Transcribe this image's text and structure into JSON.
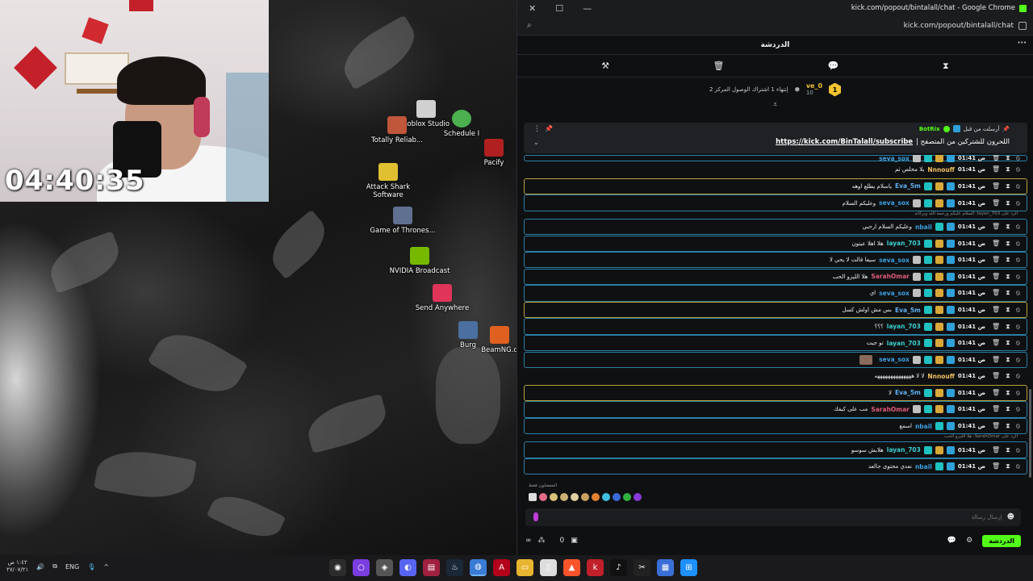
{
  "stream_overlay": {
    "timer": "04:40:35"
  },
  "desktop_icons": [
    {
      "label": "Roblox Studio",
      "color": "#d0d0d0"
    },
    {
      "label": "Schedule I",
      "color": "#4caf50"
    },
    {
      "label": "Totally Reliab...",
      "color": "#c0563a"
    },
    {
      "label": "Pacify",
      "color": "#b02020"
    },
    {
      "label": "Attack Shark Software",
      "color": "#e0c030"
    },
    {
      "label": "Game of Thrones...",
      "color": "#607090"
    },
    {
      "label": "NVIDIA Broadcast",
      "color": "#76b900"
    },
    {
      "label": "Send Anywhere",
      "color": "#e0345a"
    },
    {
      "label": "Burg",
      "color": "#4a6fa0"
    },
    {
      "label": "BeamNG.d",
      "color": "#e06020"
    }
  ],
  "chrome": {
    "title": "kick.com/popout/bintalall/chat - Google Chrome",
    "url": "kick.com/popout/bintalall/chat",
    "window_controls": [
      "✕",
      "☐",
      "—"
    ]
  },
  "chat": {
    "header": "الدردشة",
    "more": "···",
    "toolbar_icons": [
      "hammer-icon",
      "trash-icon",
      "chat-bubble-icon",
      "hourglass-icon"
    ],
    "leaderboard": {
      "rank": "1",
      "username": "ve_0",
      "points": "10",
      "text": "إنتهاء 1 اشتراك الوصول المركز 2"
    },
    "pinned": {
      "prefix": "أرسلت من قبل",
      "author": "BotRix",
      "link": "https://kick.com/BinTalall/subscribe",
      "message": "| اللحرون للشتركين من المتصفح"
    },
    "messages": [
      {
        "time": "01:41 ص",
        "user": "seva_sox",
        "user_color": "#3aa0e0",
        "text": "",
        "border": "blue",
        "badges": [
          "blue",
          "gold",
          "teal",
          "grey"
        ],
        "partial": true
      },
      {
        "time": "01:41 ص",
        "user": "Nnnouff",
        "user_color": "#f0c060",
        "text": "يلا مخلص ثم",
        "border": "plain",
        "badges": []
      },
      {
        "time": "01:41 ص",
        "user": "Eva_5m",
        "user_color": "#60b0f0",
        "text": "ياسلام يطلع اوهه",
        "border": "gold",
        "badges": [
          "blue",
          "gold",
          "teal"
        ]
      },
      {
        "time": "01:41 ص",
        "user": "seva_sox",
        "user_color": "#3aa0e0",
        "text": "وعليكم السلام",
        "border": "blue",
        "badges": [
          "blue",
          "gold",
          "teal",
          "grey"
        ]
      },
      {
        "reply": "الرد على layan_703: السلام عليكم ورحمة الله وبركاته"
      },
      {
        "time": "01:41 ص",
        "user": "nbail",
        "user_color": "#3aa0e0",
        "text": "وعليكم السلام ارحبي",
        "border": "blue",
        "badges": [
          "blue",
          "teal"
        ]
      },
      {
        "time": "01:41 ص",
        "user": "layan_703",
        "user_color": "#3ad0d0",
        "text": "هلا اهلا عيتون",
        "border": "blue",
        "badges": [
          "blue",
          "gold",
          "teal"
        ]
      },
      {
        "time": "01:41 ص",
        "user": "seva_sox",
        "user_color": "#3aa0e0",
        "text": "سيفا قالت لا يحي لا",
        "border": "blue",
        "badges": [
          "blue",
          "gold",
          "teal",
          "grey"
        ]
      },
      {
        "time": "01:41 ص",
        "user": "SarahOmar",
        "user_color": "#e05a7a",
        "text": "هلا الليزو الحب",
        "border": "blue",
        "badges": [
          "blue",
          "gold",
          "teal",
          "grey"
        ]
      },
      {
        "time": "01:41 ص",
        "user": "seva_sox",
        "user_color": "#3aa0e0",
        "text": "اي",
        "border": "blue",
        "badges": [
          "blue",
          "gold",
          "teal",
          "grey"
        ]
      },
      {
        "time": "01:41 ص",
        "user": "Eva_5m",
        "user_color": "#60b0f0",
        "text": "بس مش اولش كسل",
        "border": "gold",
        "badges": [
          "blue",
          "gold",
          "teal"
        ]
      },
      {
        "time": "01:41 ص",
        "user": "layan_703",
        "user_color": "#3ad0d0",
        "text": "؟؟؟",
        "border": "blue",
        "badges": [
          "blue",
          "gold",
          "teal"
        ]
      },
      {
        "time": "01:41 ص",
        "user": "layan_703",
        "user_color": "#3ad0d0",
        "text": "تو جيت",
        "border": "blue",
        "badges": [
          "blue",
          "gold",
          "teal"
        ]
      },
      {
        "time": "01:41 ص",
        "user": "seva_sox",
        "user_color": "#3aa0e0",
        "text": "",
        "border": "blue",
        "badges": [
          "blue",
          "gold",
          "teal",
          "grey"
        ],
        "emote": true
      },
      {
        "time": "01:41 ص",
        "user": "Nnnouff",
        "user_color": "#f0c060",
        "text": "لا لا ههههههههههههههه",
        "border": "plain",
        "badges": []
      },
      {
        "time": "01:41 ص",
        "user": "Eva_5m",
        "user_color": "#60b0f0",
        "text": "لا",
        "border": "gold",
        "badges": [
          "blue",
          "gold",
          "teal"
        ]
      },
      {
        "time": "01:41 ص",
        "user": "SarahOmar",
        "user_color": "#e05a7a",
        "text": "مب على كيفك",
        "border": "blue",
        "badges": [
          "blue",
          "gold",
          "teal",
          "grey"
        ]
      },
      {
        "time": "01:41 ص",
        "user": "nbail",
        "user_color": "#3aa0e0",
        "text": "اسمع",
        "border": "blue",
        "badges": [
          "blue",
          "teal"
        ]
      },
      {
        "reply": "الرد على SarahOmar: هلا الليزو الحب"
      },
      {
        "time": "01:41 ص",
        "user": "layan_703",
        "user_color": "#3ad0d0",
        "text": "هلابش سوسو",
        "border": "blue",
        "badges": [
          "blue",
          "gold",
          "teal"
        ]
      },
      {
        "time": "01:41 ص",
        "user": "nbail",
        "user_color": "#3aa0e0",
        "text": "نعدي محتوى جالعد",
        "border": "blue",
        "badges": [
          "blue",
          "teal"
        ]
      }
    ],
    "emote_label": "المفضلون فقط",
    "input_placeholder": "إرسال رسالة",
    "points": "0",
    "send_label": "الدردشة"
  },
  "taskbar": {
    "clock_time": "١:٤٢ ص",
    "clock_date": "٢٧/٠٧/٢١",
    "language": "ENG",
    "apps": [
      {
        "name": "obs",
        "color": "#2c2c2c",
        "glyph": "◉"
      },
      {
        "name": "circle-app",
        "color": "#7a3de0",
        "glyph": "○"
      },
      {
        "name": "roblox",
        "color": "#555",
        "glyph": "◈"
      },
      {
        "name": "discord",
        "color": "#5865f2",
        "glyph": "◐"
      },
      {
        "name": "winrar",
        "color": "#a02040",
        "glyph": "▤"
      },
      {
        "name": "steam",
        "color": "#1b2838",
        "glyph": "♨"
      },
      {
        "name": "chrome",
        "color": "#3a7bd5",
        "glyph": "◍",
        "active": true
      },
      {
        "name": "adobe",
        "color": "#b3001b",
        "glyph": "A"
      },
      {
        "name": "explorer",
        "color": "#e8b530",
        "glyph": "▭"
      },
      {
        "name": "notepad",
        "color": "#dddddd",
        "glyph": "▯"
      },
      {
        "name": "brave",
        "color": "#fb542b",
        "glyph": "▲"
      },
      {
        "name": "kick",
        "color": "#c0202a",
        "glyph": "k"
      },
      {
        "name": "tiktok",
        "color": "#111",
        "glyph": "♪"
      },
      {
        "name": "capcut",
        "color": "#222",
        "glyph": "✂"
      },
      {
        "name": "store",
        "color": "#3a6fd8",
        "glyph": "▦"
      },
      {
        "name": "start",
        "color": "#1e90ff",
        "glyph": "⊞"
      }
    ]
  }
}
